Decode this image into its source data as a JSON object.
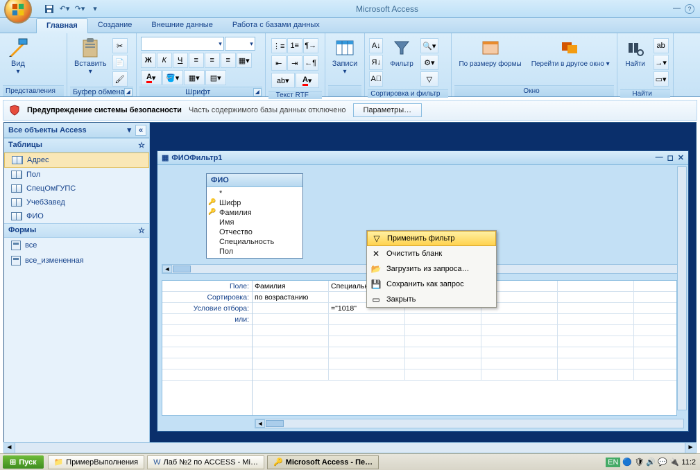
{
  "app_title": "Microsoft Access",
  "tabs": {
    "t0": "Главная",
    "t1": "Создание",
    "t2": "Внешние данные",
    "t3": "Работа с базами данных"
  },
  "ribbon": {
    "g1": "Представления",
    "g1_btn": "Вид",
    "g2": "Буфер обмена",
    "g2_btn": "Вставить",
    "g3": "Шрифт",
    "g4": "Текст RTF",
    "g5_btn": "Записи",
    "g6": "Сортировка и фильтр",
    "g6_btn": "Фильтр",
    "g7": "Окно",
    "g7_btn1": "По размеру формы",
    "g7_btn2": "Перейти в другое окно ▾",
    "g8": "Найти",
    "g8_btn": "Найти"
  },
  "security": {
    "title": "Предупреждение системы безопасности",
    "msg": "Часть содержимого базы данных отключено",
    "btn": "Параметры…"
  },
  "nav": {
    "header": "Все объекты Access",
    "cat1": "Таблицы",
    "t": {
      "i0": "Адрес",
      "i1": "Пол",
      "i2": "СпецОмГУПС",
      "i3": "УчебЗавед",
      "i4": "ФИО"
    },
    "cat2": "Формы",
    "f": {
      "i0": "все",
      "i1": "все_измененная"
    }
  },
  "qwin": {
    "title": "ФИОФильтр1",
    "table": "ФИО",
    "fields": {
      "f0": "*",
      "f1": "Шифр",
      "f2": "Фамилия",
      "f3": "Имя",
      "f4": "Отчество",
      "f5": "Специальность",
      "f6": "Пол"
    },
    "rows": {
      "r0": "Поле:",
      "r1": "Сортировка:",
      "r2": "Условие отбора:",
      "r3": "или:"
    },
    "cells": {
      "c00": "Фамилия",
      "c01": "Специальн",
      "c10": "по возрастанию",
      "c21": "=\"1018\""
    }
  },
  "ctx": {
    "m0": "Применить фильтр",
    "m1": "Очистить бланк",
    "m2": "Загрузить из запроса…",
    "m3": "Сохранить как запрос",
    "m4": "Закрыть"
  },
  "taskbar": {
    "start": "Пуск",
    "b0": "ПримерВыполнения",
    "b1": "Лаб №2 по ACCESS - Mi…",
    "b2": "Microsoft Access - Пе…",
    "lang": "EN",
    "time": "11:2"
  }
}
